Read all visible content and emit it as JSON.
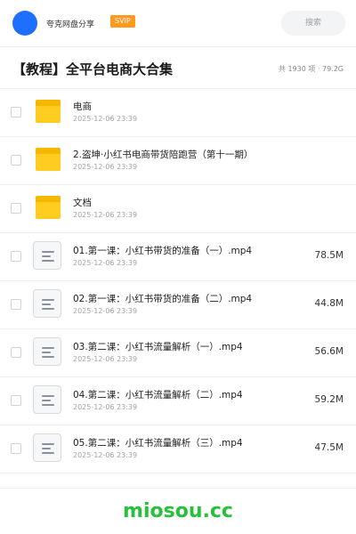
{
  "header": {
    "brand": "夸克网盘分享",
    "badge": "SVIP",
    "search_placeholder": "搜索"
  },
  "titlebar": {
    "title": "【教程】全平台电商大合集",
    "summary": "共 1930 项 · 79.2G"
  },
  "items": [
    {
      "type": "folder",
      "name": "电商",
      "date": "2025-12-06 23:39",
      "size": ""
    },
    {
      "type": "folder",
      "name": "2.盗坤·小红书电商带货陪跑营（第十一期）",
      "date": "2025-12-06 23:39",
      "size": ""
    },
    {
      "type": "folder",
      "name": "文档",
      "date": "2025-12-06 23:39",
      "size": ""
    },
    {
      "type": "file",
      "name": "01.第一课：小红书带货的准备（一）.mp4",
      "date": "2025-12-06 23:39",
      "size": "78.5M"
    },
    {
      "type": "file",
      "name": "02.第一课：小红书带货的准备（二）.mp4",
      "date": "2025-12-06 23:39",
      "size": "44.8M"
    },
    {
      "type": "file",
      "name": "03.第二课：小红书流量解析（一）.mp4",
      "date": "2025-12-06 23:39",
      "size": "56.6M"
    },
    {
      "type": "file",
      "name": "04.第二课：小红书流量解析（二）.mp4",
      "date": "2025-12-06 23:39",
      "size": "59.2M"
    },
    {
      "type": "file",
      "name": "05.第二课：小红书流量解析（三）.mp4",
      "date": "2025-12-06 23:39",
      "size": "47.5M"
    }
  ],
  "icons": {
    "folder": "folder-icon",
    "file": "video-file-icon"
  },
  "colors": {
    "accent": "#1e6fff",
    "badge": "#ff9a1f",
    "folder": "#ffcc1f",
    "watermark": "#27c03b"
  },
  "watermark": "miosou.cc"
}
